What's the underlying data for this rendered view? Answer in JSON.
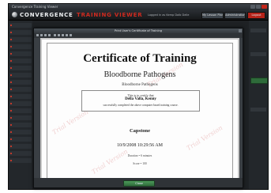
{
  "window": {
    "title": "Convergence Training Viewer"
  },
  "brand": {
    "part1": "CONVERGENCE",
    "part2": "TRAINING VIEWER"
  },
  "header": {
    "logged_in": "Logged in as Kemp Dalb Delle",
    "buttons": [
      "My Lesson Plan",
      "Administration",
      "Logout"
    ]
  },
  "dialog": {
    "title": "Print User's Certificate of Training",
    "close_label": "Close"
  },
  "certificate": {
    "title": "Certificate of Training",
    "course": "Bloodborne Pathogens",
    "course_sub": "Bloodborne Pathogens",
    "certify_line": "This is to certify that",
    "name": "Della Valla, Kenny",
    "completed_line": "successfully completed the above computer based training course.",
    "company": "Capstone",
    "date": "10/9/2008 10:29:56 AM",
    "duration": "Duration = 6 minutes",
    "score": "Score = 100",
    "watermark": "Trial Version"
  },
  "colors": {
    "accent": "#cf2a1f",
    "chrome": "#1e2124",
    "ok_button": "#2f6c3b"
  }
}
